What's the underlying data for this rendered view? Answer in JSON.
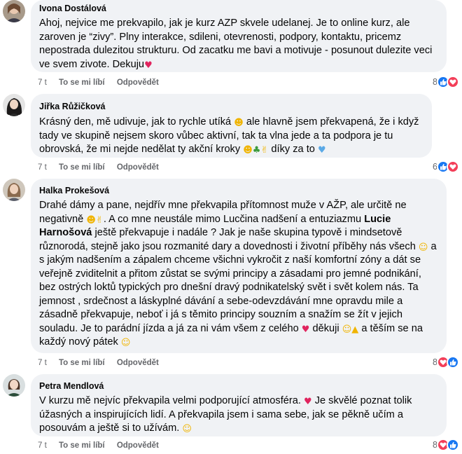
{
  "comments": [
    {
      "author": "Ivona Dostálová",
      "text": "Ahoj, nejvice me prekvapilo, jak je kurz AZP skvele udelanej. Je to online kurz, ale zaroven je “zivy”. Plny interakce, sdileni, otevrenosti, podpory, kontaktu, pricemz nepostrada dulezitou strukturu. Od zacatku me bavi a motivuje - posunout dulezite veci ve svem zivote. Dekuju",
      "time": "7 t",
      "like_label": "To se mi líbí",
      "reply_label": "Odpovědět",
      "reaction_count": "8",
      "reactions": [
        "like-icon",
        "love-icon"
      ]
    },
    {
      "author": "Jiřka Růžičková",
      "text_1": "Krásný den, mě udivuje, jak to rychle utíká",
      "text_2": "ale hlavně jsem překvapená, že i když tady ve skupině nejsem skoro vůbec aktivní, tak ta vlna jede a ta podpora je tu obrovská, že mi nejde nedělat ty akční kroky",
      "text_3": "díky za to",
      "time": "7 t",
      "like_label": "To se mi líbí",
      "reply_label": "Odpovědět",
      "reaction_count": "6",
      "reactions": [
        "like-icon",
        "love-icon"
      ]
    },
    {
      "author": "Halka Prokešová",
      "text_1": "Drahé dámy a pane, nejdřív mne překvapila přítomnost muže v AŽP, ale určitě ne negativně",
      "text_2": ". A co mne neustále mimo Lucčina nadšení a entuziazmu",
      "mention": "Lucie Harnošová",
      "text_3": "ještě překvapuje i nadále ? Jak je naše skupina typově i mindsetově různorodá, stejně jako jsou rozmanité dary a dovednosti i životní příběhy nás všech",
      "text_4": "a s jakým nadšením a zápalem chceme všichni vykročit z naší komfortní zóny a dát se veřejně zviditelnit a přitom zůstat se svými principy a zásadami pro jemné podnikání, bez ostrých loktů typických pro dnešní dravý podnikatelský svět i svět kolem nás. Ta jemnost , srdečnost a láskyplné dávání a sebe-odevzdávání mne opravdu mile a zásadně překvapuje, neboť i já s těmito principy souzním a snažím se žít v jejich souladu. Je to parádní jízda a já za ni vám všem z celého",
      "text_5": "děkuji",
      "text_6": "a těším se na každý nový pátek",
      "time": "7 t",
      "like_label": "To se mi líbí",
      "reply_label": "Odpovědět",
      "reaction_count": "8",
      "reactions": [
        "love-icon",
        "like-icon"
      ]
    },
    {
      "author": "Petra Mendlová",
      "text_1": "V kurzu mě nejvíc překvapila velmi podporující atmosféra.",
      "text_2": "Je skvělé poznat tolik úžasných a inspirujících lidí. A překvapila jsem i sama sebe, jak se pěkně učím a posouvám a ještě si to užívám.",
      "time": "7 t",
      "like_label": "To se mi líbí",
      "reply_label": "Odpovědět",
      "reaction_count": "8",
      "reactions": [
        "love-icon",
        "like-icon"
      ]
    }
  ]
}
